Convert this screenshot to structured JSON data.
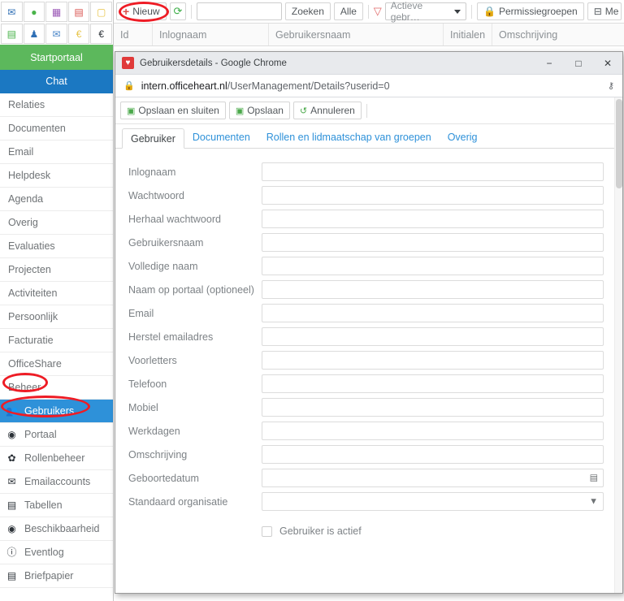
{
  "app": {
    "quick_icons": [
      {
        "name": "mail-icon",
        "glyph": "✉",
        "color": "#2f6fb5"
      },
      {
        "name": "chat-bubble-icon",
        "glyph": "●",
        "color": "#49b34a"
      },
      {
        "name": "calendar-icon",
        "glyph": "▦",
        "color": "#9b59b6"
      },
      {
        "name": "building-icon",
        "glyph": "▤",
        "color": "#d9534f"
      },
      {
        "name": "note-icon",
        "glyph": "▢",
        "color": "#e8c54a"
      },
      {
        "name": "list-icon",
        "glyph": "▤",
        "color": "#49b34a"
      },
      {
        "name": "person-podium-icon",
        "glyph": "♟",
        "color": "#2f6fb5"
      },
      {
        "name": "envelope-outline-icon",
        "glyph": "✉",
        "color": "#4a86c8"
      },
      {
        "name": "euro-yellow-icon",
        "glyph": "€",
        "color": "#e8c54a"
      },
      {
        "name": "euro-dark-icon",
        "glyph": "€",
        "color": "#2b3137"
      }
    ],
    "nav": [
      {
        "label": "Startportaal",
        "style": "green",
        "icon": null
      },
      {
        "label": "Chat",
        "style": "blue",
        "icon": null
      },
      {
        "label": "Relaties",
        "style": "plain",
        "icon": null
      },
      {
        "label": "Documenten",
        "style": "plain",
        "icon": null
      },
      {
        "label": "Email",
        "style": "plain",
        "icon": null
      },
      {
        "label": "Helpdesk",
        "style": "plain",
        "icon": null
      },
      {
        "label": "Agenda",
        "style": "plain",
        "icon": null
      },
      {
        "label": "Overig",
        "style": "plain",
        "icon": null
      },
      {
        "label": "Evaluaties",
        "style": "plain",
        "icon": null
      },
      {
        "label": "Projecten",
        "style": "plain",
        "icon": null
      },
      {
        "label": "Activiteiten",
        "style": "plain",
        "icon": null
      },
      {
        "label": "Persoonlijk",
        "style": "plain",
        "icon": null
      },
      {
        "label": "Facturatie",
        "style": "plain",
        "icon": null
      },
      {
        "label": "OfficeShare",
        "style": "plain",
        "icon": null
      },
      {
        "label": "Beheer",
        "style": "plain",
        "icon": null
      },
      {
        "label": "Gebruikers",
        "style": "selected",
        "icon": "users-icon"
      },
      {
        "label": "Portaal",
        "style": "plain",
        "icon": "gauge-icon"
      },
      {
        "label": "Rollenbeheer",
        "style": "plain",
        "icon": "gear-icon"
      },
      {
        "label": "Emailaccounts",
        "style": "plain",
        "icon": "envelope-icon"
      },
      {
        "label": "Tabellen",
        "style": "plain",
        "icon": "database-icon"
      },
      {
        "label": "Beschikbaarheid",
        "style": "plain",
        "icon": "gauge-icon"
      },
      {
        "label": "Eventlog",
        "style": "plain",
        "icon": "info-icon"
      },
      {
        "label": "Briefpapier",
        "style": "plain",
        "icon": "document-icon"
      }
    ],
    "toolbar": {
      "new_label": "Nieuw",
      "new_plus": "+",
      "refresh_icon": "refresh-icon",
      "search_value": "",
      "search_button": "Zoeken",
      "all_button": "Alle",
      "filter_icon": "funnel-icon",
      "filter_selected": "Actieve gebr…",
      "permission_groups": "Permissiegroepen",
      "permission_icon": "lock-icon",
      "last_button": "Me",
      "last_icon": "org-chart-icon"
    },
    "grid_columns": [
      "Id",
      "Inlognaam",
      "Gebruikersnaam",
      "Initialen",
      "Omschrijving"
    ]
  },
  "window": {
    "title": "Gebruikersdetails - Google Chrome",
    "favicon": "heart-favicon",
    "favicon_glyph": "♥",
    "minimize": "−",
    "maximize": "□",
    "close": "✕",
    "lock_icon": "padlock-icon",
    "url_host": "intern.officeheart.nl",
    "url_path": "/UserManagement/Details?userid=0",
    "key_icon": "key-icon"
  },
  "dialog": {
    "toolbar": [
      {
        "label": "Opslaan en sluiten",
        "icon": "save-icon",
        "glyph": "▣"
      },
      {
        "label": "Opslaan",
        "icon": "save-icon",
        "glyph": "▣"
      },
      {
        "label": "Annuleren",
        "icon": "undo-icon",
        "glyph": "↺"
      }
    ],
    "tabs": [
      {
        "label": "Gebruiker",
        "active": true
      },
      {
        "label": "Documenten",
        "active": false
      },
      {
        "label": "Rollen en lidmaatschap van groepen",
        "active": false
      },
      {
        "label": "Overig",
        "active": false
      }
    ],
    "fields": [
      {
        "label": "Inlognaam",
        "value": "",
        "type": "text"
      },
      {
        "label": "Wachtwoord",
        "value": "",
        "type": "password"
      },
      {
        "label": "Herhaal wachtwoord",
        "value": "",
        "type": "password"
      },
      {
        "label": "Gebruikersnaam",
        "value": "",
        "type": "text"
      },
      {
        "label": "Volledige naam",
        "value": "",
        "type": "text"
      },
      {
        "label": "Naam op portaal (optioneel)",
        "value": "",
        "type": "text"
      },
      {
        "label": "Email",
        "value": "",
        "type": "text"
      },
      {
        "label": "Herstel emailadres",
        "value": "",
        "type": "text"
      },
      {
        "label": "Voorletters",
        "value": "",
        "type": "text"
      },
      {
        "label": "Telefoon",
        "value": "",
        "type": "text"
      },
      {
        "label": "Mobiel",
        "value": "",
        "type": "text"
      },
      {
        "label": "Werkdagen",
        "value": "",
        "type": "text"
      },
      {
        "label": "Omschrijving",
        "value": "",
        "type": "text"
      },
      {
        "label": "Geboortedatum",
        "value": "",
        "type": "date",
        "icon": "calendar-icon",
        "glyph": "▤"
      },
      {
        "label": "Standaard organisatie",
        "value": "",
        "type": "select",
        "icon": "chevron-down-icon",
        "glyph": "▼"
      }
    ],
    "checkbox": {
      "label": "Gebruiker is actief",
      "checked": false
    }
  },
  "colors": {
    "green": "#5cb85c",
    "blue": "#1b78c2",
    "selected_blue": "#2e91d9",
    "annotation_red": "#ee1c25"
  }
}
